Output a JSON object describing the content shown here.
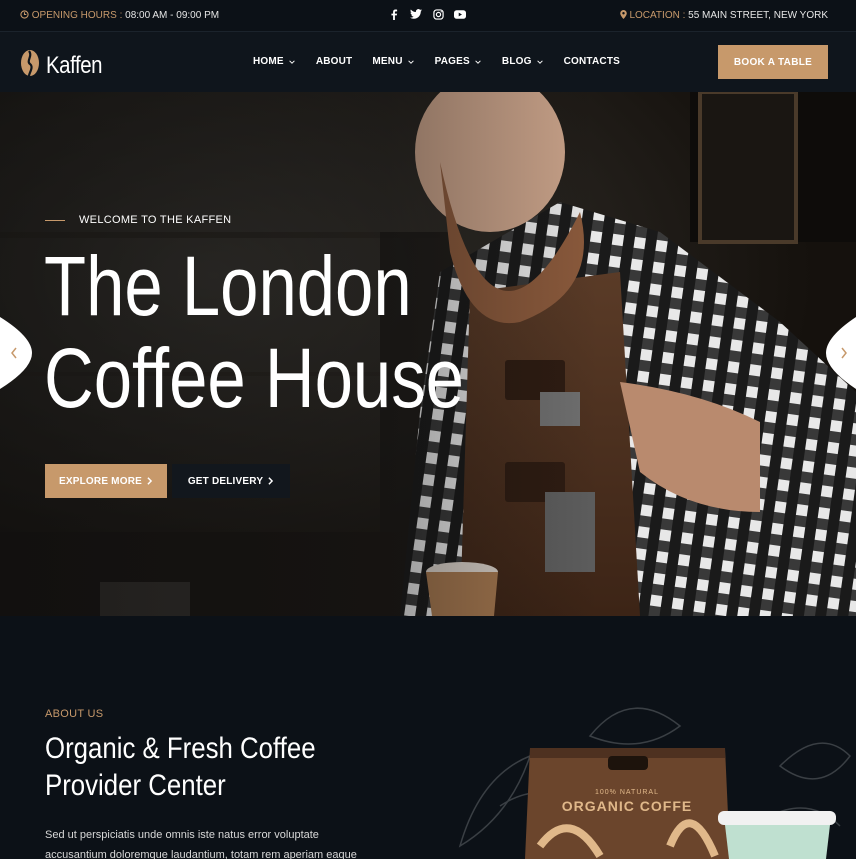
{
  "topbar": {
    "hours_label": "OPENING HOURS :",
    "hours_value": "08:00 AM - 09:00 PM",
    "location_label": "LOCATION :",
    "location_value": "55 MAIN STREET, NEW YORK",
    "social": [
      "facebook-icon",
      "twitter-icon",
      "instagram-icon",
      "youtube-icon"
    ]
  },
  "header": {
    "logo_text": "Kaffen",
    "nav": [
      {
        "label": "HOME",
        "dropdown": true
      },
      {
        "label": "ABOUT",
        "dropdown": false
      },
      {
        "label": "MENU",
        "dropdown": true
      },
      {
        "label": "PAGES",
        "dropdown": true
      },
      {
        "label": "BLOG",
        "dropdown": true
      },
      {
        "label": "CONTACTS",
        "dropdown": false
      }
    ],
    "cta_label": "BOOK A TABLE"
  },
  "hero": {
    "kicker": "WELCOME TO THE KAFFEN",
    "title_line1": "The London",
    "title_line2": "Coffee House",
    "btn_explore": "EXPLORE MORE",
    "btn_delivery": "GET DELIVERY"
  },
  "about": {
    "label": "ABOUT US",
    "title_line1": "Organic & Fresh Coffee",
    "title_line2": "Provider Center",
    "text": "Sed ut perspiciatis unde omnis iste natus error voluptate accusantium doloremque laudantium, totam rem aperiam eaque",
    "package_small": "100% NATURAL",
    "package_big": "ORGANIC COFFE"
  },
  "colors": {
    "accent": "#c7996b",
    "dark": "#0c1117",
    "header": "#0f151c"
  }
}
